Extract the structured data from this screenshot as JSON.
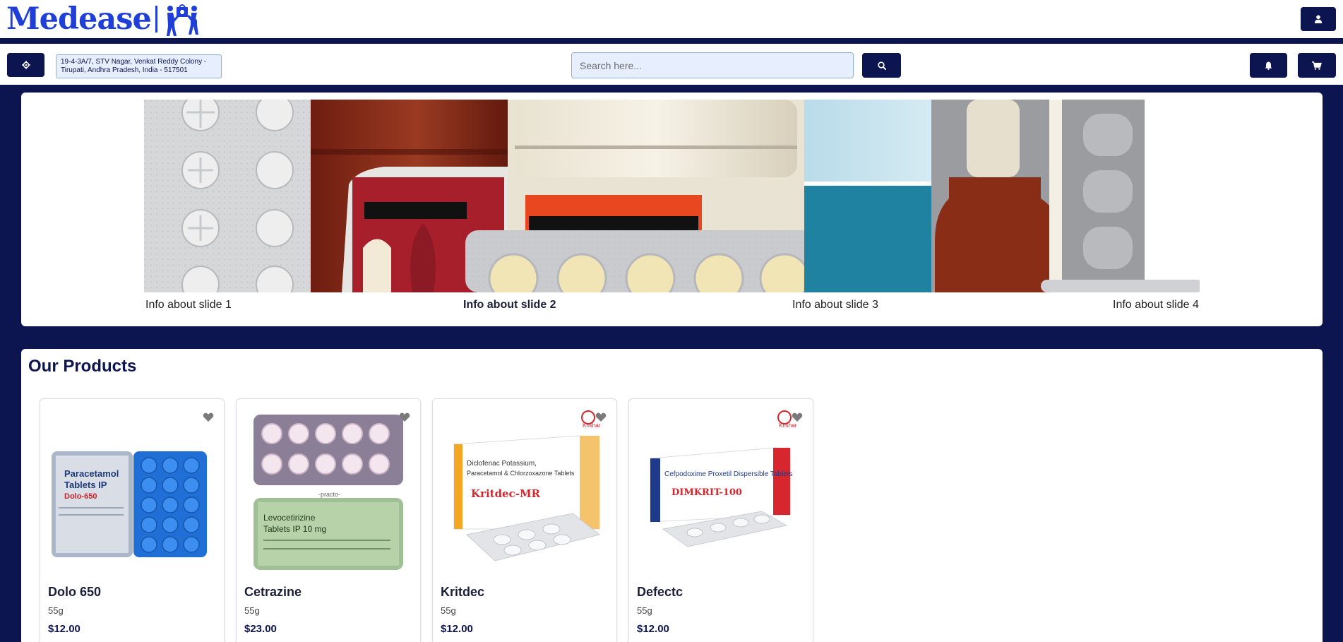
{
  "brand": {
    "name": "Medease"
  },
  "header": {
    "address_line1": "19-4-3A/7, STV Nagar, Venkat Reddy Colony -",
    "address_line2": "Tirupati, Andhra Pradesh, India - 517501",
    "search_placeholder": "Search here...",
    "icons": {
      "user": "user-icon",
      "location": "crosshair-icon",
      "search": "search-icon",
      "bell": "bell-icon",
      "cart": "cart-icon"
    }
  },
  "carousel": {
    "slides": [
      {
        "caption": "Info about slide 1",
        "active": false
      },
      {
        "caption": "Info about slide 2",
        "active": true
      },
      {
        "caption": "Info about slide 3",
        "active": false
      },
      {
        "caption": "Info about slide 4",
        "active": false
      }
    ]
  },
  "products": {
    "title": "Our Products",
    "items": [
      {
        "name": "Dolo 650",
        "weight": "55g",
        "price": "$12.00",
        "package_text": [
          "Paracetamol",
          "Tablets IP",
          "Dolo-650"
        ]
      },
      {
        "name": "Cetrazine",
        "weight": "55g",
        "price": "$23.00",
        "package_text": [
          "Levocetirizine",
          "Tablets IP 10 mg",
          "-practo-"
        ]
      },
      {
        "name": "Kritdec",
        "weight": "55g",
        "price": "$12.00",
        "package_text": [
          "Diclofenac Potassium,",
          "Paracetamol & Chlorzoxazone Tablets",
          "Kritdec-MR",
          "Krishar"
        ]
      },
      {
        "name": "Defectc",
        "weight": "55g",
        "price": "$12.00",
        "package_text": [
          "Cefpodoxime Proxetil Dispersible Tablets",
          "DIMKRIT-100",
          "Krishar"
        ]
      }
    ]
  },
  "colors": {
    "navy": "#0d1550",
    "brand_blue": "#1f3fd8",
    "input_bg": "#e7efff"
  }
}
